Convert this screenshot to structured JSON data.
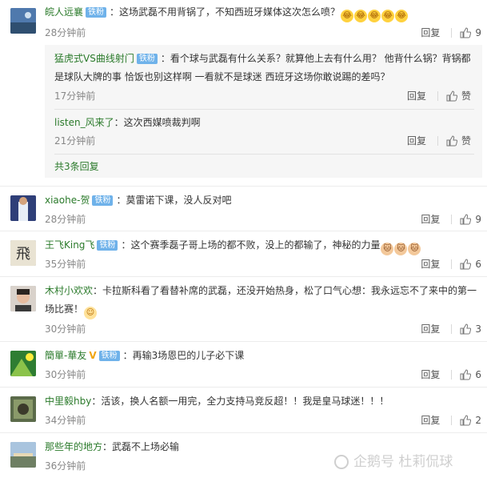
{
  "labels": {
    "reply": "回复",
    "like": "赞",
    "fan_badge": "铁粉"
  },
  "comments": [
    {
      "user": "皖人远襄",
      "verified": false,
      "fan": true,
      "content": "：这场武磊不用背锅了，不知西班牙媒体这次怎么喷？",
      "emojis": [
        "laugh",
        "laugh",
        "laugh",
        "laugh",
        "laugh"
      ],
      "time": "28分钟前",
      "likes": "9",
      "replies": [
        {
          "user": "猛虎式VS曲线射门",
          "fan": true,
          "content": "：看个球与武磊有什么关系？就算他上去有什么用？ 他背什么锅？背锅都是球队大牌的事 恰饭也别这样啊 一看就不是球迷 西班牙这场你敢说踢的差吗？",
          "time": "17分钟前",
          "likes": ""
        },
        {
          "user": "listen_风来了",
          "fan": false,
          "content": "：这次西媒喷裁判啊",
          "time": "21分钟前",
          "likes": ""
        }
      ],
      "more": "共3条回复"
    },
    {
      "user": "xiaohe-贺",
      "verified": false,
      "fan": true,
      "content": "：莫雷诺下课，没人反对吧",
      "emojis": [],
      "time": "28分钟前",
      "likes": "9"
    },
    {
      "user": "王飞King飞",
      "verified": false,
      "fan": true,
      "content": "：这个赛季磊子哥上场的都不败，没上的都输了，神秘的力量",
      "emojis": [
        "cat",
        "cat",
        "cat"
      ],
      "time": "35分钟前",
      "likes": "6"
    },
    {
      "user": "木村小欢欢",
      "verified": false,
      "fan": false,
      "content": "：卡拉斯科看了看替补席的武磊，还没开始热身，松了口气心想：我永远忘不了来中的第一场比赛！",
      "emojis": [
        "shy"
      ],
      "time": "30分钟前",
      "likes": "3"
    },
    {
      "user": "簡單-華友",
      "verified": true,
      "fan": true,
      "content": "：再输3场恩巴的儿子必下课",
      "emojis": [],
      "time": "30分钟前",
      "likes": "6"
    },
    {
      "user": "中里毅hby",
      "verified": false,
      "fan": false,
      "content": "：活该，换人名额一用完，全力支持马竞反超！！我是皇马球迷！！！",
      "emojis": [],
      "time": "34分钟前",
      "likes": "2"
    },
    {
      "user": "那些年的地方",
      "verified": false,
      "fan": false,
      "content": "：武磊不上场必输",
      "emojis": [],
      "time": "36分钟前",
      "likes": ""
    }
  ],
  "watermark": "企鹅号 杜莉侃球",
  "colors": {
    "username": "#2a7a2a",
    "fan_badge": "#6fb2ea",
    "reply_box": "#f6f6f6"
  }
}
